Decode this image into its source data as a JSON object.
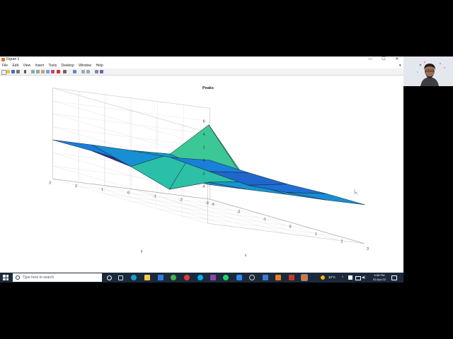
{
  "window": {
    "title": "Figure 1",
    "controls": {
      "minimize": "—",
      "maximize": "☐",
      "close": "✕"
    }
  },
  "menu": {
    "items": [
      "File",
      "Edit",
      "View",
      "Insert",
      "Tools",
      "Desktop",
      "Window",
      "Help"
    ]
  },
  "toolbar": {
    "icons": [
      "new-figure-icon",
      "open-icon",
      "save-icon",
      "print-icon",
      "edit-plot-icon",
      "zoom-in-icon",
      "zoom-out-icon",
      "pan-icon",
      "rotate-icon",
      "data-cursor-icon",
      "brush-icon",
      "link-icon",
      "colorbar-icon",
      "legend-icon",
      "hide-tools-icon",
      "show-tools-icon"
    ]
  },
  "chart_data": {
    "type": "surface",
    "title": "Peaks",
    "xlabel": "x",
    "ylabel": "y",
    "zlabel": "",
    "x": [
      -3,
      -1.5,
      0,
      1.5,
      3
    ],
    "y": [
      -3,
      -1.5,
      0,
      1.5,
      3
    ],
    "xticks": [
      "-3",
      "-2",
      "-1",
      "0",
      "1",
      "2",
      "3"
    ],
    "yticks": [
      "-3",
      "-2",
      "-1",
      "0",
      "1",
      "2",
      "3"
    ],
    "zticks": [
      "-4",
      "-2",
      "0",
      "2",
      "4",
      "6"
    ],
    "xlim": [
      -3,
      3
    ],
    "ylim": [
      -3,
      3
    ],
    "zlim": [
      -6,
      8
    ],
    "z": [
      [
        0.0001,
        -0.2,
        -0.25,
        0,
        0
      ],
      [
        -0.35,
        -0.8,
        -1.2,
        -0.6,
        -0.05
      ],
      [
        -0.06,
        1.1,
        7.3,
        0.3,
        0.03
      ],
      [
        0.02,
        -1.6,
        -3.4,
        -0.6,
        0.0
      ],
      [
        0,
        0.05,
        0.0,
        -0.05,
        0
      ]
    ],
    "grid": true
  },
  "taskbar": {
    "search_placeholder": "Type here to search",
    "temperature": "34°C",
    "time": "6:58 PM",
    "date": "02-Apr-22"
  }
}
